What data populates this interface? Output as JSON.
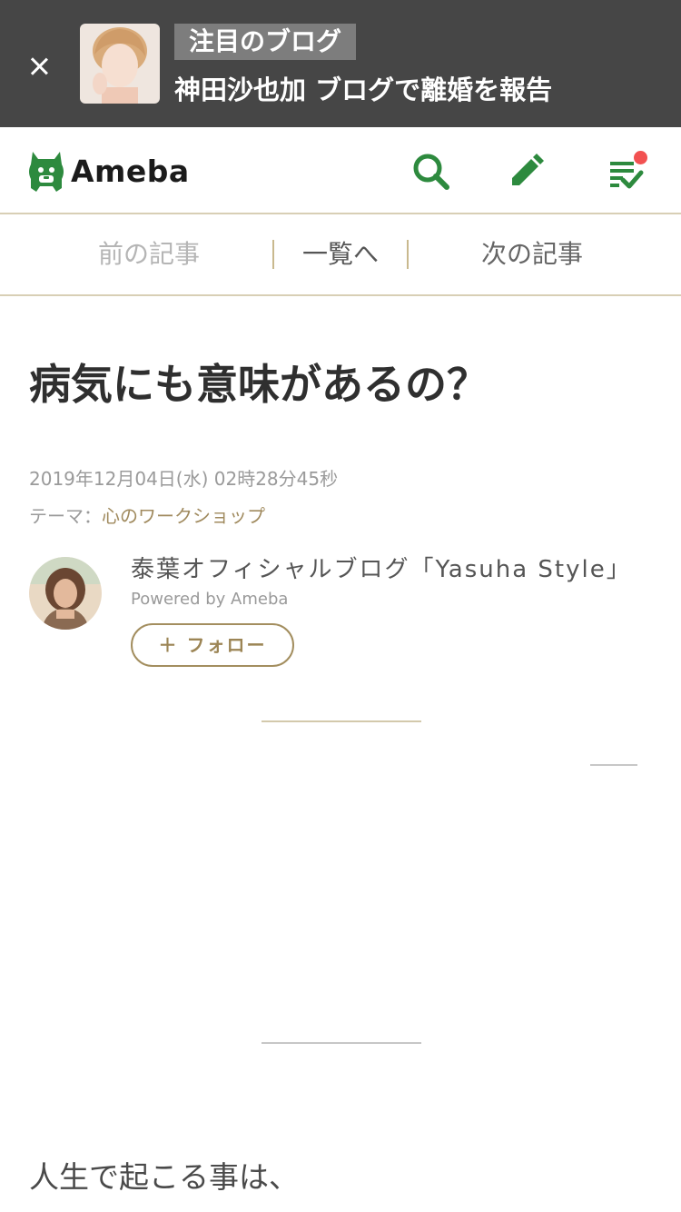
{
  "promo": {
    "badge": "注目のブログ",
    "title": "神田沙也加 ブログで離婚を報告"
  },
  "header": {
    "logo_text": "Ameba",
    "icons": [
      "search-icon",
      "edit-icon",
      "reader-list-icon"
    ],
    "accent_color": "#2d8a3e",
    "notification_color": "#f25151"
  },
  "nav": {
    "prev": "前の記事",
    "list": "一覧へ",
    "next": "次の記事"
  },
  "article": {
    "title": "病気にも意味があるの？",
    "date": "2019年12月04日(水) 02時28分45秒",
    "theme_label": "テーマ：",
    "theme_value": "心のワークショップ",
    "body_first_line": "人生で起こる事は、"
  },
  "blog": {
    "name": "泰葉オフィシャルブログ「Yasuha Style」",
    "powered_by": "Powered by Ameba",
    "follow_label": "＋ フォロー"
  }
}
